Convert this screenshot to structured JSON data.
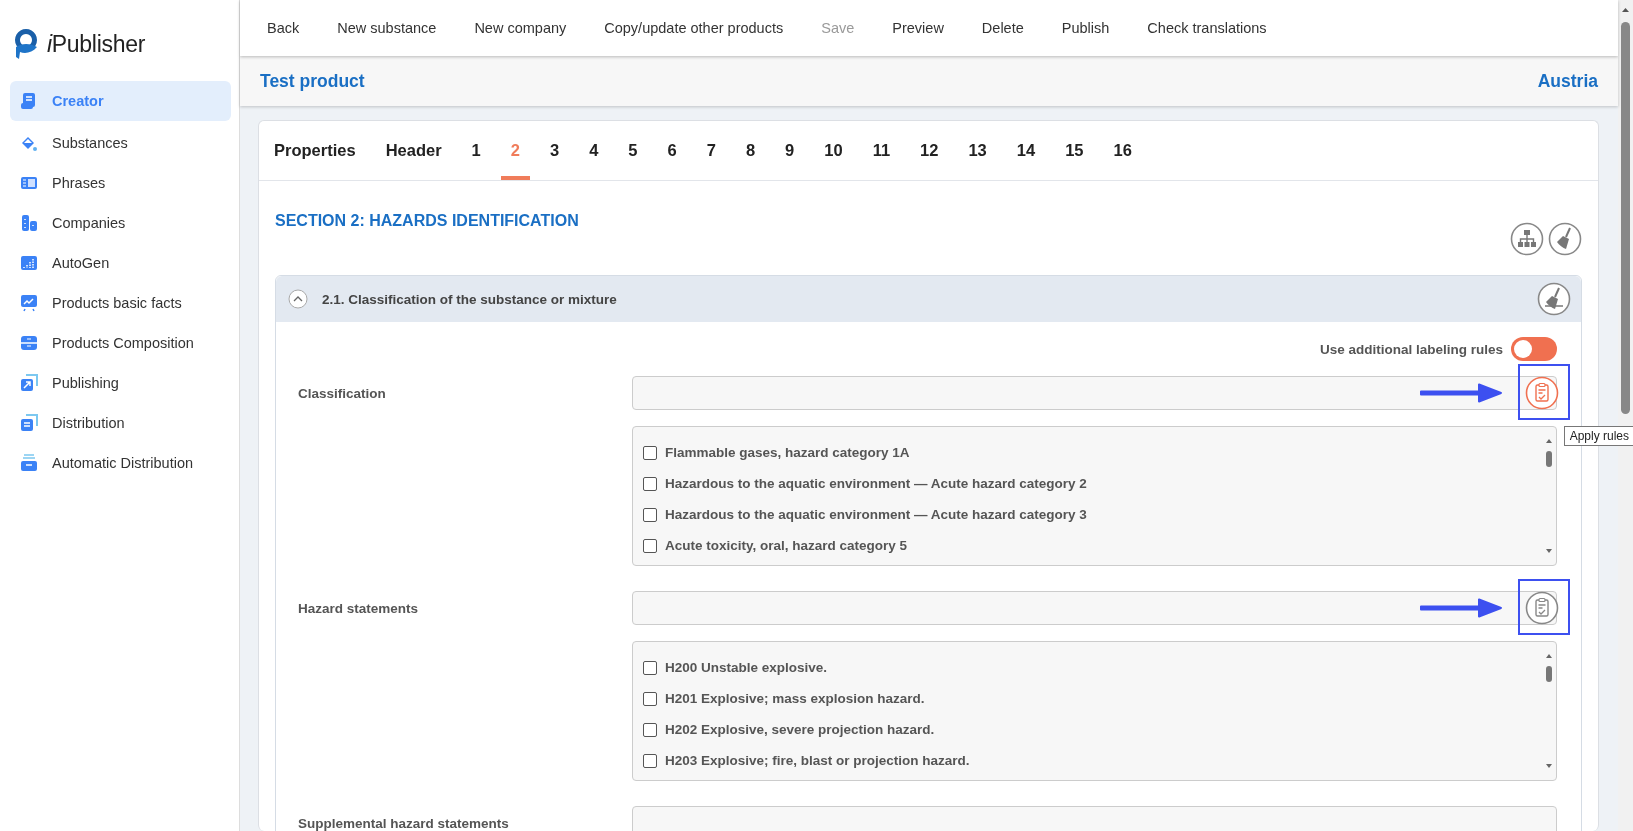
{
  "app": {
    "name": "iPublisher"
  },
  "sidebar": {
    "items": [
      {
        "label": "Creator",
        "selected": true
      },
      {
        "label": "Substances",
        "selected": false
      },
      {
        "label": "Phrases",
        "selected": false
      },
      {
        "label": "Companies",
        "selected": false
      },
      {
        "label": "AutoGen",
        "selected": false
      },
      {
        "label": "Products basic facts",
        "selected": false
      },
      {
        "label": "Products Composition",
        "selected": false
      },
      {
        "label": "Publishing",
        "selected": false
      },
      {
        "label": "Distribution",
        "selected": false
      },
      {
        "label": "Automatic Distribution",
        "selected": false
      }
    ]
  },
  "toolbar": {
    "items": [
      {
        "label": "Back",
        "disabled": false
      },
      {
        "label": "New substance",
        "disabled": false
      },
      {
        "label": "New company",
        "disabled": false
      },
      {
        "label": "Copy/update other products",
        "disabled": false
      },
      {
        "label": "Save",
        "disabled": true
      },
      {
        "label": "Preview",
        "disabled": false
      },
      {
        "label": "Delete",
        "disabled": false
      },
      {
        "label": "Publish",
        "disabled": false
      },
      {
        "label": "Check translations",
        "disabled": false
      }
    ]
  },
  "header": {
    "title": "Test product",
    "country": "Austria"
  },
  "tabs": [
    {
      "label": "Properties",
      "selected": false
    },
    {
      "label": "Header",
      "selected": false
    },
    {
      "label": "1",
      "selected": false
    },
    {
      "label": "2",
      "selected": true
    },
    {
      "label": "3",
      "selected": false
    },
    {
      "label": "4",
      "selected": false
    },
    {
      "label": "5",
      "selected": false
    },
    {
      "label": "6",
      "selected": false
    },
    {
      "label": "7",
      "selected": false
    },
    {
      "label": "8",
      "selected": false
    },
    {
      "label": "9",
      "selected": false
    },
    {
      "label": "10",
      "selected": false
    },
    {
      "label": "11",
      "selected": false
    },
    {
      "label": "12",
      "selected": false
    },
    {
      "label": "13",
      "selected": false
    },
    {
      "label": "14",
      "selected": false
    },
    {
      "label": "15",
      "selected": false
    },
    {
      "label": "16",
      "selected": false
    }
  ],
  "section": {
    "title": "SECTION 2: HAZARDS IDENTIFICATION"
  },
  "subsection": {
    "title": "2.1. Classification of the substance or mixture",
    "expanded": true,
    "labeling_toggle": {
      "label": "Use additional labeling rules",
      "on": false
    },
    "fields": [
      {
        "label": "Classification",
        "apply_button": {
          "hovered": true,
          "annotated": true,
          "tooltip": "Apply rules"
        },
        "options": [
          {
            "label": "Flammable gases, hazard category 1A",
            "checked": false
          },
          {
            "label": "Hazardous to the aquatic environment — Acute hazard category 2",
            "checked": false
          },
          {
            "label": "Hazardous to the aquatic environment — Acute hazard category 3",
            "checked": false
          },
          {
            "label": "Acute toxicity, oral, hazard category 5",
            "checked": false
          }
        ]
      },
      {
        "label": "Hazard statements",
        "apply_button": {
          "hovered": false,
          "annotated": true
        },
        "options": [
          {
            "label": "H200 Unstable explosive.",
            "checked": false
          },
          {
            "label": "H201 Explosive; mass explosion hazard.",
            "checked": false
          },
          {
            "label": "H202 Explosive, severe projection hazard.",
            "checked": false
          },
          {
            "label": "H203 Explosive; fire, blast or projection hazard.",
            "checked": false
          }
        ]
      },
      {
        "label": "Supplemental hazard statements"
      }
    ]
  }
}
